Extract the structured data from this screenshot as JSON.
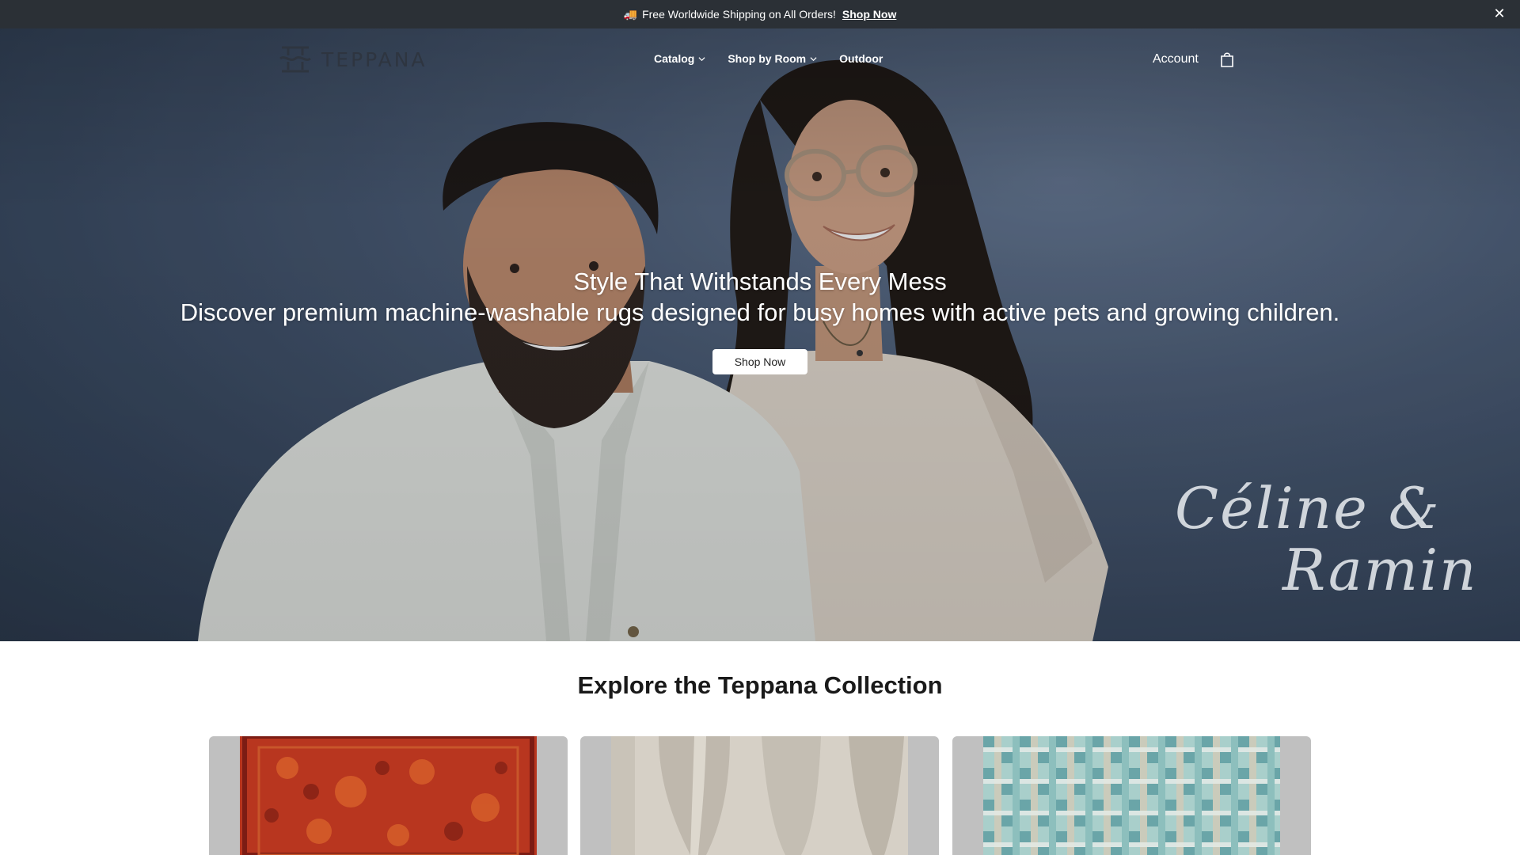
{
  "announcement": {
    "message": "Free Worldwide Shipping on All Orders!",
    "link_label": "Shop Now",
    "truck_icon": "truck-icon",
    "close_icon": "close-icon"
  },
  "header": {
    "brand": "TEPPANA",
    "nav": [
      {
        "label": "Catalog",
        "has_dropdown": true
      },
      {
        "label": "Shop by Room",
        "has_dropdown": true
      },
      {
        "label": "Outdoor",
        "has_dropdown": false
      }
    ],
    "account_label": "Account",
    "cart_icon": "shopping-bag-icon"
  },
  "hero": {
    "title": "Style That Withstands Every Mess",
    "subtitle": "Discover premium machine-washable rugs designed for busy homes with active pets and growing children.",
    "cta_label": "Shop Now",
    "signature_line1": "Céline &",
    "signature_line2": "Ramin"
  },
  "collection": {
    "title": "Explore the Teppana Collection",
    "cards": [
      {
        "pattern": "red-distressed-vintage-rug",
        "color": "#b8361f"
      },
      {
        "pattern": "beige-arched-abstract-rug",
        "color": "#d6d0c6"
      },
      {
        "pattern": "teal-checkered-rug",
        "color": "#8fbdbc"
      }
    ]
  },
  "colors": {
    "announcement_bg": "#2b3036",
    "hero_wall": "#4b5c75",
    "text_dark": "#1a1a1a",
    "card_bg": "#c0c0c0"
  }
}
